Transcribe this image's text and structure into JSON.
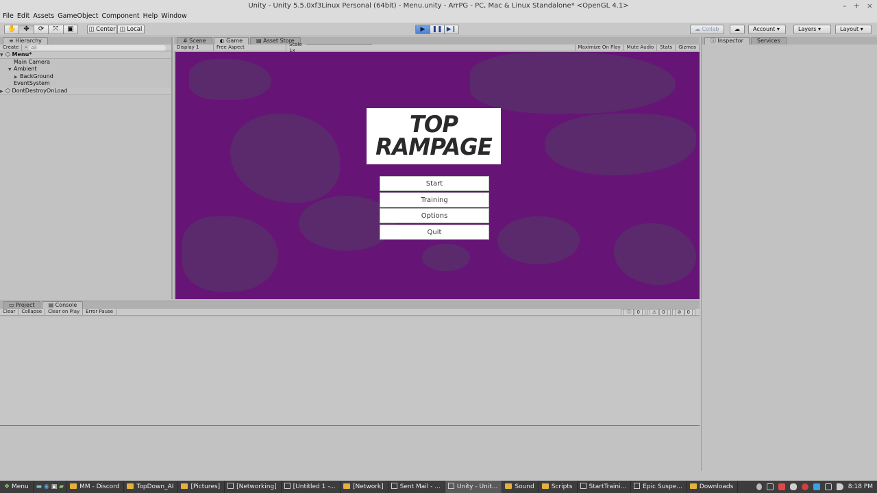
{
  "window": {
    "title": "Unity - Unity 5.5.0xf3Linux Personal (64bit) - Menu.unity - ArrPG - PC, Mac & Linux Standalone* <OpenGL 4.1>",
    "controls": [
      "–",
      "+",
      "×"
    ]
  },
  "menu": [
    "File",
    "Edit",
    "Assets",
    "GameObject",
    "Component",
    "Help",
    "Window"
  ],
  "toolbar": {
    "tools": [
      "hand",
      "move",
      "rotate",
      "scale",
      "rect"
    ],
    "pivot_label": "Center",
    "space_label": "Local",
    "collab_label": "Collab",
    "account_label": "Account",
    "layers_label": "Layers",
    "layout_label": "Layout"
  },
  "hierarchy": {
    "tab": "Hierarchy",
    "create_label": "Create",
    "search_placeholder": "All",
    "items": [
      {
        "label": "Menu*",
        "type": "scene"
      },
      {
        "label": "Main Camera"
      },
      {
        "label": "Ambient"
      },
      {
        "label": "BackGround"
      },
      {
        "label": "EventSystem"
      },
      {
        "label": "DontDestroyOnLoad",
        "type": "scene"
      }
    ]
  },
  "game_panel": {
    "tabs": [
      "Scene",
      "Game",
      "Asset Store"
    ],
    "display": "Display 1",
    "aspect": "Free Aspect",
    "scale_label": "Scale",
    "scale_value": "1x",
    "options": [
      "Maximize On Play",
      "Mute Audio",
      "Stats",
      "Gizmos"
    ]
  },
  "game": {
    "logo_line1": "TOP",
    "logo_line2": "RAMPAGE",
    "buttons": [
      "Start",
      "Training",
      "Options",
      "Quit"
    ],
    "bg_color": "#661577"
  },
  "inspector": {
    "tabs": [
      "Inspector",
      "Services"
    ]
  },
  "console": {
    "tabs": [
      "Project",
      "Console"
    ],
    "buttons": [
      "Clear",
      "Collapse",
      "Clear on Play",
      "Error Pause"
    ],
    "counts": [
      "0",
      "0",
      "0"
    ]
  },
  "taskbar": {
    "menu_label": "Menu",
    "tasks": [
      {
        "label": "MM - Discord",
        "icon": "folder"
      },
      {
        "label": "TopDown_AI",
        "icon": "folder"
      },
      {
        "label": "[Pictures]",
        "icon": "folder"
      },
      {
        "label": "[Networking]",
        "icon": "window"
      },
      {
        "label": "[Untitled 1 -...",
        "icon": "window"
      },
      {
        "label": "[Network]",
        "icon": "folder"
      },
      {
        "label": "Sent Mail - ...",
        "icon": "window"
      },
      {
        "label": "Unity - Unit...",
        "icon": "window",
        "active": true
      },
      {
        "label": "Sound",
        "icon": "folder"
      },
      {
        "label": "Scripts",
        "icon": "folder"
      },
      {
        "label": "StartTraini...",
        "icon": "window"
      },
      {
        "label": "Epic Suspe...",
        "icon": "window"
      },
      {
        "label": "Downloads",
        "icon": "folder"
      }
    ],
    "clock": "8:18 PM"
  }
}
